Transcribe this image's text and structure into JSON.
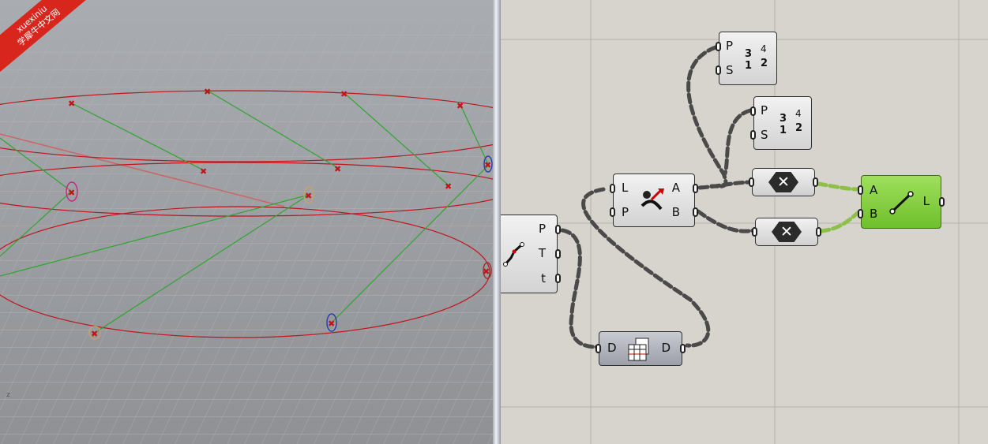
{
  "watermark": {
    "line1": "xuexiniu",
    "line2": "学犀牛中文网"
  },
  "viewport": {
    "axis_label": "z"
  },
  "nodes": {
    "sort_top": {
      "in_p": "P",
      "in_s": "S",
      "icon_top": "3",
      "icon_top_r": "4",
      "icon_bot": "1",
      "icon_bot_r": "2"
    },
    "sort_mid": {
      "in_p": "P",
      "in_s": "S",
      "icon_top": "3",
      "icon_top_r": "4",
      "icon_bot": "1",
      "icon_bot_r": "2"
    },
    "closest": {
      "in_l": "L",
      "in_p": "P",
      "out_a": "A",
      "out_b": "B"
    },
    "curve": {
      "out_p": "P",
      "out_t": "T",
      "out_t2": "t"
    },
    "cull_top": {
      "glyph": "✕"
    },
    "cull_bottom": {
      "glyph": "✕"
    },
    "line": {
      "in_a": "A",
      "in_b": "B",
      "out_l": "L"
    },
    "data": {
      "in_d": "D",
      "out_d": "D"
    }
  },
  "colors": {
    "circle": "#c0141c",
    "link": "#2fa52f",
    "wire": "#4a4a4a",
    "wire_selected": "#8cc048",
    "node_green": "#7ecf3a"
  }
}
